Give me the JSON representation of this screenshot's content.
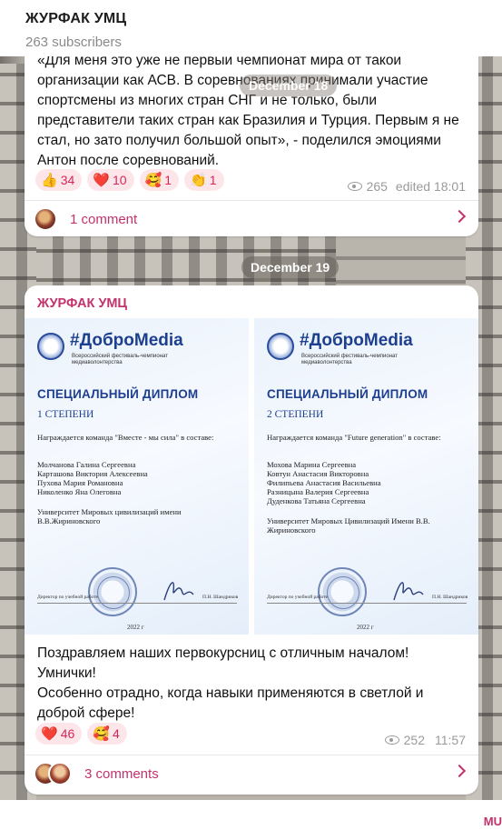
{
  "header": {
    "channel_name": "ЖУРФАК УМЦ",
    "subscribers": "263 subscribers"
  },
  "floating_date": "December 18",
  "post1": {
    "text": "«Для меня это уже не первый чемпионат мира от такой организации как АСВ. В соревнованиях принимали участие спортсмены из многих стран СНГ и не только,  были представители таких стран как Бразилия и Турция. Первым я не стал, но зато получил большой опыт», - поделился эмоциями Антон после соревнований.",
    "reactions": [
      {
        "emoji": "👍",
        "count": "34"
      },
      {
        "emoji": "❤️",
        "count": "10"
      },
      {
        "emoji": "🥰",
        "count": "1"
      },
      {
        "emoji": "👏",
        "count": "1"
      }
    ],
    "views": "265",
    "time": "edited 18:01",
    "comments": "1 comment"
  },
  "date_separator": "December 19",
  "post2": {
    "channel": "ЖУРФАК УМЦ",
    "diplomas": [
      {
        "brand": "#ДоброMedia",
        "brand_sub": "Всероссийский фестиваль-чемпионат медиаволонтерства",
        "title": "СПЕЦИАЛЬНЫЙ ДИПЛОМ",
        "degree": "1 СТЕПЕНИ",
        "awarded": "Награждается команда  \"Вместе - мы сила\" в составе:",
        "members": "Молчанова Галина Сергеевна\nКарташова Виктория Алексеевна\nПухова Мария Романовна\nНиколенко Яна Олеговна",
        "university": "Университет Мировых цивилизаций имени В.В.Жириновского",
        "sign_left": "Директор по учебной работе",
        "sign_right": "П.Н. Шандриков",
        "year": "2022 г"
      },
      {
        "brand": "#ДоброMedia",
        "brand_sub": "Всероссийский фестиваль-чемпионат медиаволонтерства",
        "title": "СПЕЦИАЛЬНЫЙ ДИПЛОМ",
        "degree": "2 СТЕПЕНИ",
        "awarded": "Награждается команда  \"Future generation\" в составе:",
        "members": "Мохова Марина Сергеевна\nКовтун Анастасия Викторовна\nФилипьева Анастасия Васильевна\nРазницына Валерия Сергеевна\nДуденкова Татьяна Сергеевна",
        "university": "Университет Мировых Цивилизаций Имени В.В. Жириновского",
        "sign_left": "Директор по учебной работе",
        "sign_right": "П.Н. Шандриков",
        "year": "2022 г"
      }
    ],
    "text": "Поздравляем наших первокурсниц с отличным началом! Умнички!\nОсобенно отрадно, когда навыки применяются в светлой и доброй сфере!",
    "reactions": [
      {
        "emoji": "❤️",
        "count": "46"
      },
      {
        "emoji": "🥰",
        "count": "4"
      }
    ],
    "views": "252",
    "time": "11:57",
    "comments": "3 comments"
  },
  "footer_fragment": "MU",
  "colors": {
    "accent": "#c2326b",
    "reaction_bg": "#fde6e9",
    "diploma_blue": "#1d3f8f"
  }
}
